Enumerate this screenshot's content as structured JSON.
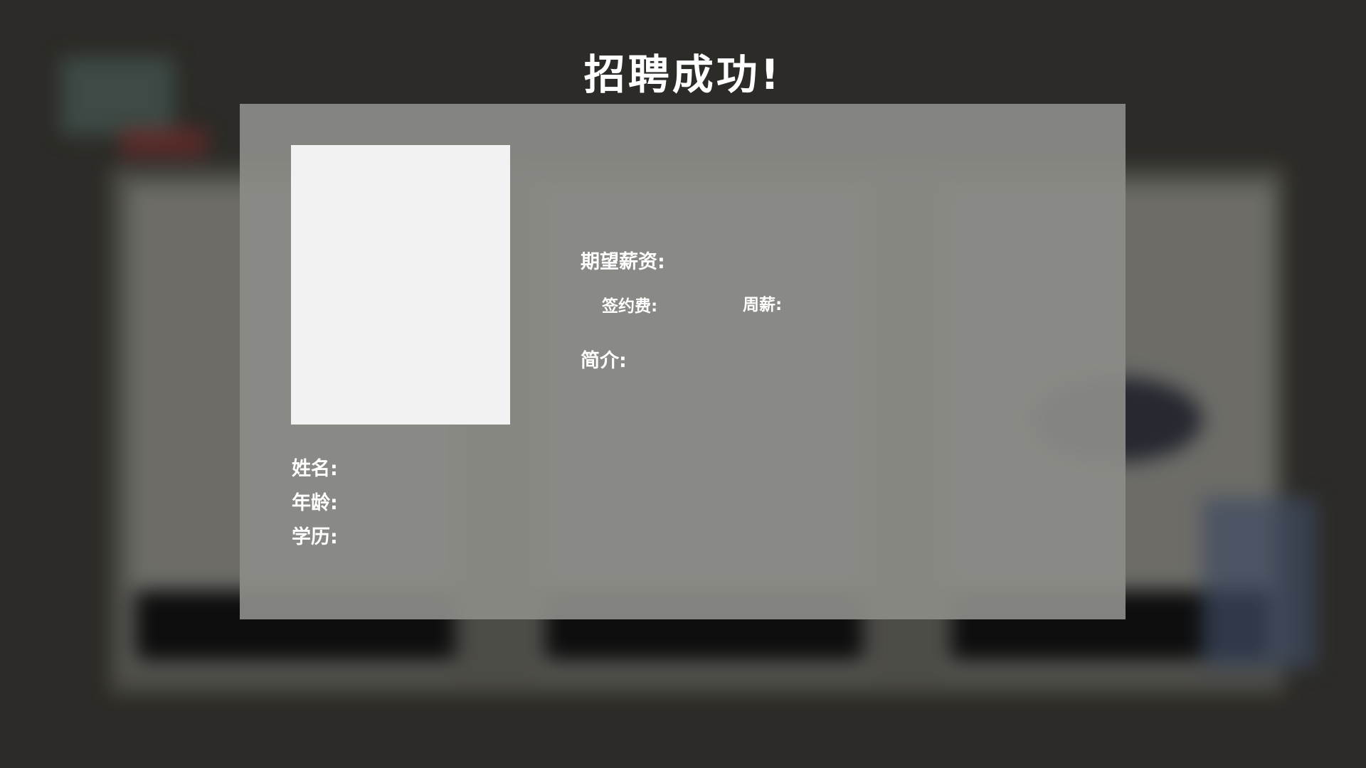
{
  "title": "招聘成功!",
  "recruit": {
    "expected_salary_label": "期望薪资:",
    "signing_fee_label": "签约费:",
    "weekly_pay_label": "周薪:",
    "intro_label": "简介:",
    "name_label": "姓名:",
    "age_label": "年龄:",
    "education_label": "学历:"
  }
}
